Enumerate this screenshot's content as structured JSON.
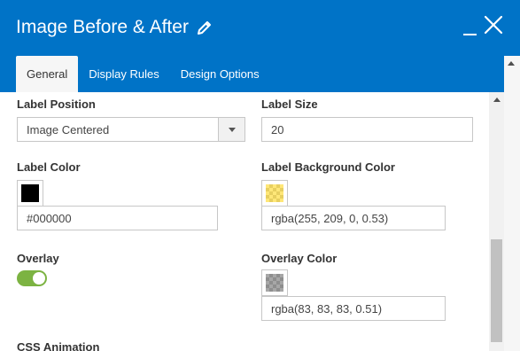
{
  "header": {
    "title": "Image Before & After",
    "edit_icon": "pencil-icon",
    "minimize_icon": "minimize-icon",
    "close_icon": "close-icon"
  },
  "tabs": [
    {
      "label": "General",
      "active": true
    },
    {
      "label": "Display Rules",
      "active": false
    },
    {
      "label": "Design Options",
      "active": false
    }
  ],
  "form": {
    "label_position": {
      "label": "Label Position",
      "value": "Image Centered"
    },
    "label_size": {
      "label": "Label Size",
      "value": "20"
    },
    "label_color": {
      "label": "Label Color",
      "value": "#000000",
      "swatch": "#000000"
    },
    "label_bg_color": {
      "label": "Label Background Color",
      "value": "rgba(255, 209, 0, 0.53)",
      "swatch": "rgba(255, 209, 0, 0.53)"
    },
    "overlay": {
      "label": "Overlay",
      "enabled": true,
      "color": "#7cb342"
    },
    "overlay_color": {
      "label": "Overlay Color",
      "value": "rgba(83, 83, 83, 0.51)",
      "swatch": "rgba(83, 83, 83, 0.51)"
    },
    "css_animation": {
      "label": "CSS Animation"
    }
  },
  "colors": {
    "accent": "#0073c7",
    "tab_active_bg": "#f6f6f6"
  }
}
